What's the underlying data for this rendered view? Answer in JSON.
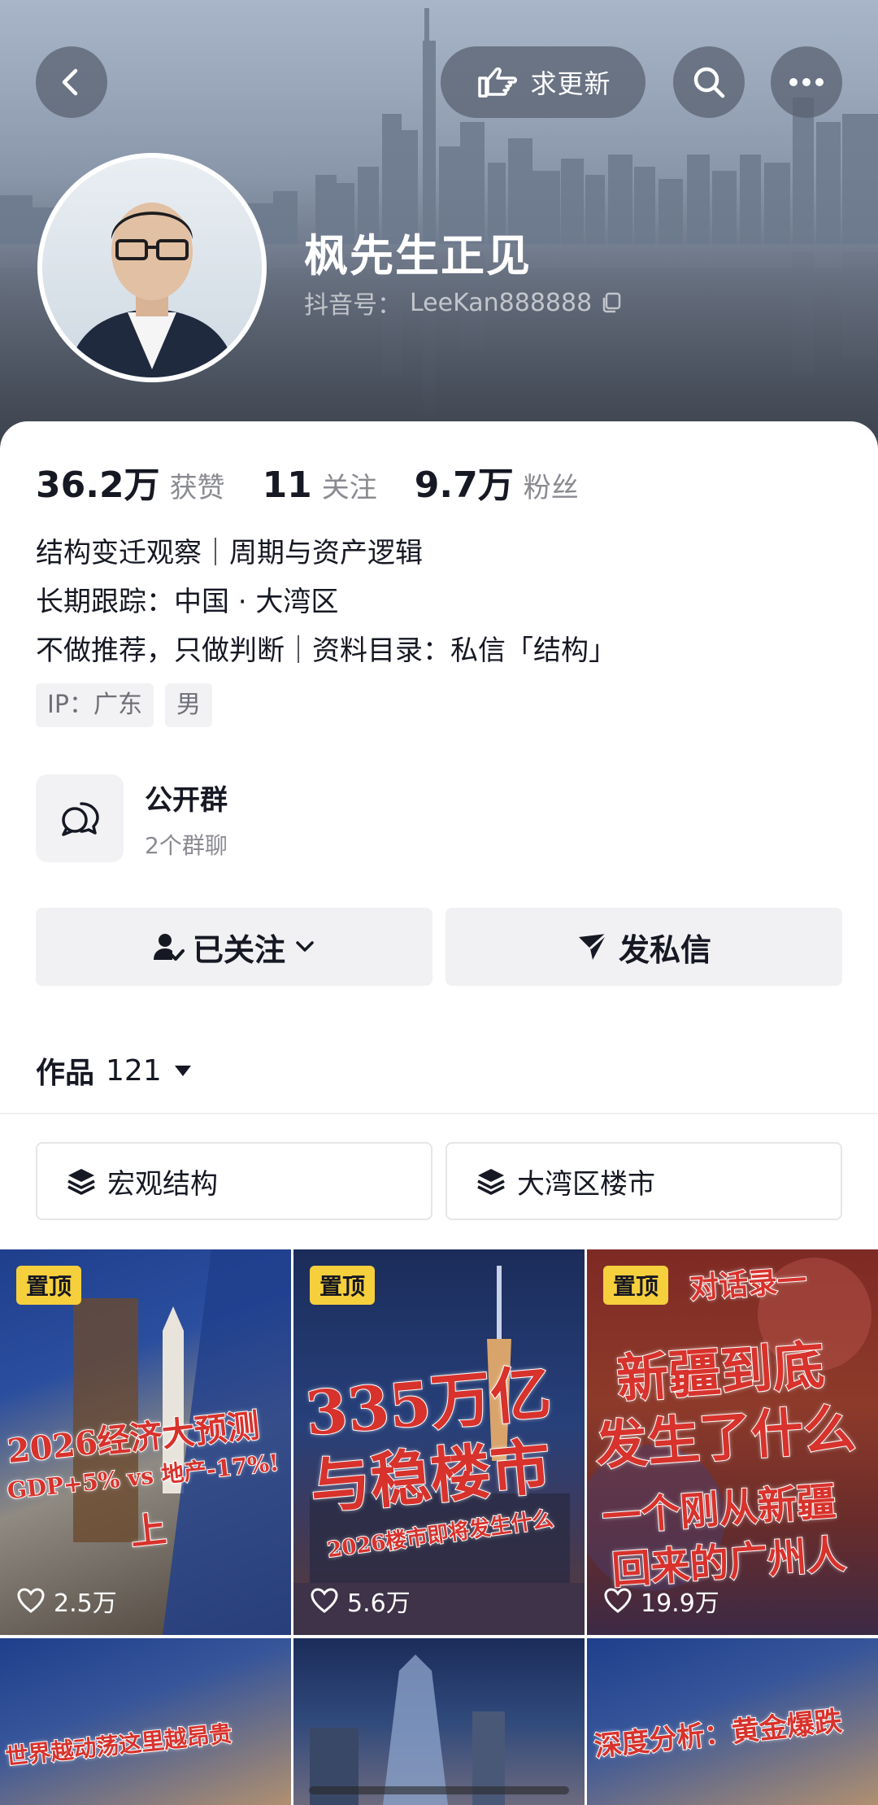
{
  "header": {
    "back_icon": "chevron-left-icon",
    "update_label": "求更新",
    "update_icon": "pointing-hand-icon",
    "search_icon": "search-icon",
    "more_icon": "more-dots-icon"
  },
  "profile": {
    "name": "枫先生正见",
    "douyin_id_label": "抖音号：",
    "douyin_id": "LeeKan888888",
    "copy_icon": "copy-icon"
  },
  "stats": [
    {
      "value": "36.2万",
      "label": "获赞"
    },
    {
      "value": "11",
      "label": "关注"
    },
    {
      "value": "9.7万",
      "label": "粉丝"
    }
  ],
  "bio": [
    "结构变迁观察｜周期与资产逻辑",
    "长期跟踪：中国 · 大湾区",
    "不做推荐，只做判断｜资料目录：私信「结构」"
  ],
  "tags": [
    "IP：广东",
    "男"
  ],
  "group": {
    "title": "公开群",
    "subtitle": "2个群聊",
    "icon": "chat-bubbles-icon"
  },
  "actions": {
    "follow_label": "已关注",
    "message_label": "发私信"
  },
  "works": {
    "label": "作品",
    "count": "121"
  },
  "collections": [
    "宏观结构",
    "大湾区楼市"
  ],
  "videos": [
    {
      "pinned": "置顶",
      "likes": "2.5万",
      "title_lines": [
        "2026经济大预测",
        "GDP+5% vs 地产-17%!",
        "上"
      ]
    },
    {
      "pinned": "置顶",
      "likes": "5.6万",
      "title_lines": [
        "335万亿",
        "与稳楼市",
        "2026楼市即将发生什么"
      ]
    },
    {
      "pinned": "置顶",
      "likes": "19.9万",
      "title_lines": [
        "对话录一",
        "新疆到底",
        "发生了什么",
        "一个刚从新疆",
        "回来的广州人"
      ]
    },
    {
      "title_lines": [
        "世界越动荡这里越昂贵"
      ]
    },
    {
      "title_lines": []
    },
    {
      "title_lines": [
        "深度分析：黄金爆跌"
      ]
    }
  ],
  "colors": {
    "accent_pin": "#f6cf3d",
    "title_red": "#d8322c",
    "button_bg": "#f1f1f3"
  }
}
